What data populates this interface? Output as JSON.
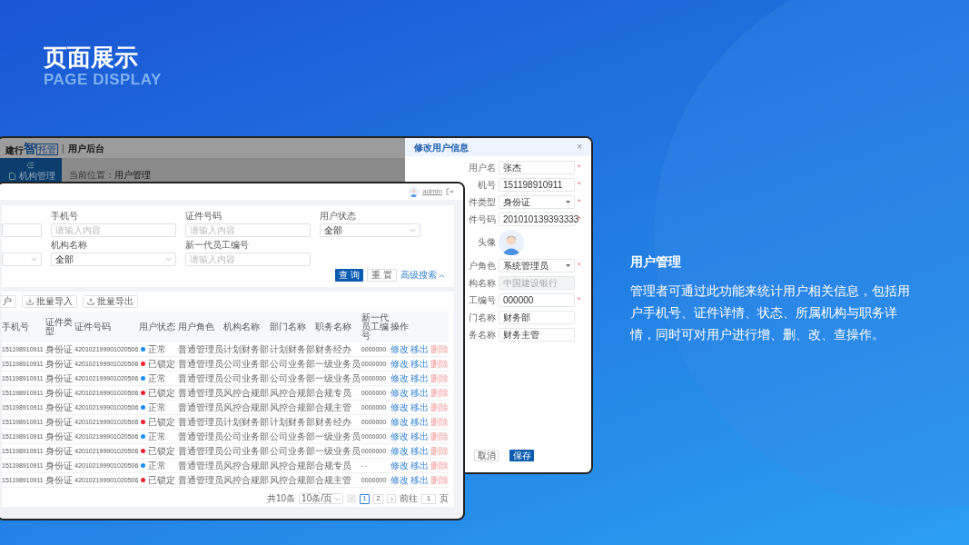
{
  "slide": {
    "title": "页面展示",
    "subtitle": "PAGE DISPLAY"
  },
  "back_app": {
    "logo": {
      "prefix": "建行",
      "mark": "智",
      "suffix": "托管"
    },
    "separator": "|",
    "title": "用户后台",
    "breadcrumb": {
      "label": "当前位置：",
      "current": "用户管理"
    },
    "sidebar": {
      "items": [
        {
          "label": "机构管理"
        }
      ]
    }
  },
  "drawer": {
    "title": "修改用户信息",
    "close": "×",
    "required_mark": "*",
    "fields": [
      {
        "label": "用户名",
        "kind": "input",
        "value": "张杰",
        "required": true,
        "disabled": false
      },
      {
        "label": "机号",
        "kind": "input",
        "value": "151198910911",
        "required": true,
        "disabled": false
      },
      {
        "label": "件类型",
        "kind": "select",
        "value": "身份证",
        "required": true,
        "disabled": false
      },
      {
        "label": "件号码",
        "kind": "input",
        "value": "201010139393333",
        "required": true,
        "disabled": false
      },
      {
        "label": "头像",
        "kind": "avatar",
        "required": false,
        "disabled": false
      },
      {
        "label": "户角色",
        "kind": "select",
        "value": "系统管理员",
        "required": true,
        "disabled": false
      },
      {
        "label": "构名称",
        "kind": "input",
        "value": "中国建设银行",
        "required": false,
        "disabled": true
      },
      {
        "label": "工编号",
        "kind": "input",
        "value": "000000",
        "required": true,
        "disabled": false
      },
      {
        "label": "门名称",
        "kind": "input",
        "value": "财务部",
        "required": false,
        "disabled": false
      },
      {
        "label": "务名称",
        "kind": "input",
        "value": "财务主管",
        "required": false,
        "disabled": false
      }
    ],
    "buttons": [
      {
        "label": "取消",
        "kind": "default"
      },
      {
        "label": "保存",
        "kind": "primary"
      }
    ]
  },
  "front_app": {
    "user": "admin",
    "filters": [
      {
        "kind": "input"
      },
      {
        "label": "手机号",
        "kind": "input",
        "placeholder": "请输入内容"
      },
      {
        "label": "证件号码",
        "kind": "input",
        "placeholder": "请输入内容"
      },
      {
        "label": "用户状态",
        "kind": "select",
        "value": "全部"
      },
      {
        "kind": "select"
      },
      {
        "label": "机构名称",
        "kind": "select",
        "value": "全部"
      },
      {
        "label": "新一代员工编号",
        "kind": "input",
        "placeholder": "请输入内容"
      }
    ],
    "filter_buttons": [
      {
        "label": "查 询",
        "kind": "primary"
      },
      {
        "label": "重 置",
        "kind": "default"
      }
    ],
    "advanced_search": {
      "label": "高级搜索",
      "expanded": true
    },
    "toolbar": [
      {
        "label": "户",
        "kind": "plain"
      },
      {
        "label": "批量导入",
        "kind": "import"
      },
      {
        "label": "批量导出",
        "kind": "export"
      }
    ],
    "table": {
      "columns": [
        {
          "label": "手机号",
          "kind": "number"
        },
        {
          "label": "证件类型",
          "kind": "text"
        },
        {
          "label": "证件号码",
          "kind": "number"
        },
        {
          "label": "用户状态",
          "kind": "status"
        },
        {
          "label": "用户角色",
          "kind": "text"
        },
        {
          "label": "机构名称",
          "kind": "text"
        },
        {
          "label": "部门名称",
          "kind": "text"
        },
        {
          "label": "职务名称",
          "kind": "text"
        },
        {
          "label": "新一代员工编号",
          "kind": "number"
        },
        {
          "label": "操作",
          "kind": "actions"
        }
      ],
      "rows": [
        [
          "151198910911",
          "身份证",
          "420102199901020506",
          {
            "text": "正常",
            "color": "#1890ff"
          },
          "普通管理员",
          "计划财务部",
          "计划财务部",
          "财务经办",
          "0000000",
          [
            {
              "label": "修改",
              "kind": "link"
            },
            {
              "label": "移出",
              "kind": "link"
            },
            {
              "label": "删除",
              "kind": "danger"
            }
          ]
        ],
        [
          "151198910911",
          "身份证",
          "420102199901020506",
          {
            "text": "已锁定",
            "color": "#f5222d"
          },
          "普通管理员",
          "公司业务部",
          "公司业务部",
          "一级业务员",
          "0000000",
          [
            {
              "label": "修改",
              "kind": "link"
            },
            {
              "label": "移出",
              "kind": "link"
            },
            {
              "label": "删除",
              "kind": "danger"
            }
          ]
        ],
        [
          "151198910911",
          "身份证",
          "420102199901020506",
          {
            "text": "正常",
            "color": "#1890ff"
          },
          "普通管理员",
          "公司业务部",
          "公司业务部",
          "一级业务员",
          "0000000",
          [
            {
              "label": "修改",
              "kind": "link"
            },
            {
              "label": "移出",
              "kind": "link"
            },
            {
              "label": "删除",
              "kind": "danger"
            }
          ]
        ],
        [
          "151198910911",
          "身份证",
          "420102199901020506",
          {
            "text": "已锁定",
            "color": "#f5222d"
          },
          "普通管理员",
          "风控合规部",
          "风控合规部",
          "合规专员",
          "0000000",
          [
            {
              "label": "修改",
              "kind": "link"
            },
            {
              "label": "移出",
              "kind": "link"
            },
            {
              "label": "删除",
              "kind": "danger"
            }
          ]
        ],
        [
          "151198910911",
          "身份证",
          "420102199901020506",
          {
            "text": "正常",
            "color": "#1890ff"
          },
          "普通管理员",
          "风控合规部",
          "风控合规部",
          "合规主管",
          "0000000",
          [
            {
              "label": "修改",
              "kind": "link"
            },
            {
              "label": "移出",
              "kind": "link"
            },
            {
              "label": "删除",
              "kind": "danger"
            }
          ]
        ],
        [
          "151198910911",
          "身份证",
          "420102199901020506",
          {
            "text": "已锁定",
            "color": "#f5222d"
          },
          "普通管理员",
          "计划财务部",
          "计划财务部",
          "财务经办",
          "0000000",
          [
            {
              "label": "修改",
              "kind": "link"
            },
            {
              "label": "移出",
              "kind": "link"
            },
            {
              "label": "删除",
              "kind": "danger"
            }
          ]
        ],
        [
          "151198910911",
          "身份证",
          "420102199901020506",
          {
            "text": "正常",
            "color": "#1890ff"
          },
          "普通管理员",
          "公司业务部",
          "公司业务部",
          "一级业务员",
          "0000000",
          [
            {
              "label": "修改",
              "kind": "link"
            },
            {
              "label": "移出",
              "kind": "link"
            },
            {
              "label": "删除",
              "kind": "danger"
            }
          ]
        ],
        [
          "151198910911",
          "身份证",
          "420102199901020506",
          {
            "text": "已锁定",
            "color": "#f5222d"
          },
          "普通管理员",
          "公司业务部",
          "公司业务部",
          "一级业务员",
          "0000000",
          [
            {
              "label": "修改",
              "kind": "link"
            },
            {
              "label": "移出",
              "kind": "link"
            },
            {
              "label": "删除",
              "kind": "danger"
            }
          ]
        ],
        [
          "151198910911",
          "身份证",
          "420102199901020506",
          {
            "text": "正常",
            "color": "#1890ff"
          },
          "普通管理员",
          "风控合规部",
          "风控合规部",
          "合规专员",
          "- -",
          [
            {
              "label": "修改",
              "kind": "link"
            },
            {
              "label": "移出",
              "kind": "link"
            },
            {
              "label": "删除",
              "kind": "danger"
            }
          ]
        ],
        [
          "151198910911",
          "身份证",
          "420102199901020506",
          {
            "text": "已锁定",
            "color": "#f5222d"
          },
          "普通管理员",
          "风控合规部",
          "风控合规部",
          "合规主管",
          "0000000",
          [
            {
              "label": "修改",
              "kind": "link"
            },
            {
              "label": "移出",
              "kind": "link"
            },
            {
              "label": "删除",
              "kind": "danger"
            }
          ]
        ]
      ]
    },
    "pagination": {
      "total": "共10条",
      "page_size": "10条/页",
      "prev": {
        "disabled": true
      },
      "pages": [
        {
          "label": "1",
          "selected": true
        },
        {
          "label": "2",
          "selected": false
        }
      ],
      "next": {
        "disabled": false
      },
      "goto_label": "前往",
      "goto_value": "1",
      "goto_suffix": "页"
    }
  },
  "feature": {
    "title": "用户管理",
    "description": "管理者可通过此功能来统计用户相关信息，包括用户手机号、证件详情、状态、所属机构与职务详情，同时可对用户进行增、删、改、查操作。"
  }
}
